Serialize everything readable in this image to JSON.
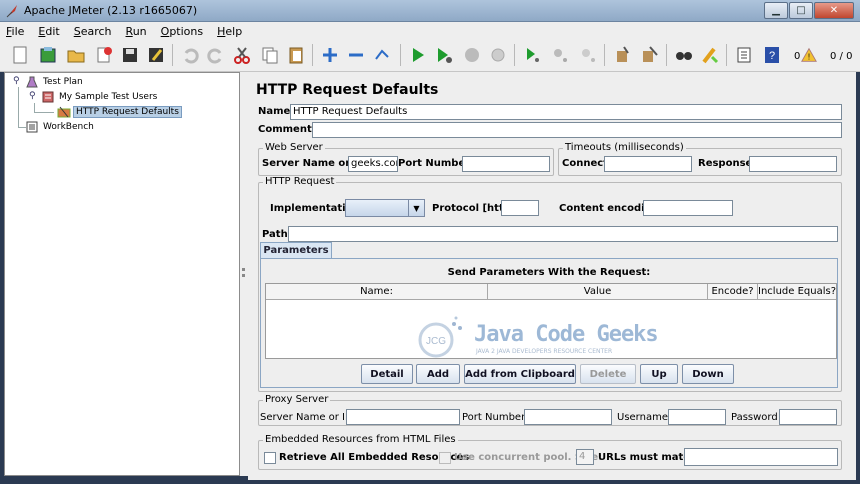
{
  "window": {
    "title": "Apache JMeter (2.13 r1665067)"
  },
  "menu": [
    {
      "label": "File",
      "u": "F",
      "rest": "ile"
    },
    {
      "label": "Edit",
      "u": "E",
      "rest": "dit"
    },
    {
      "label": "Search",
      "u": "S",
      "rest": "earch"
    },
    {
      "label": "Run",
      "u": "R",
      "rest": "un"
    },
    {
      "label": "Options",
      "u": "O",
      "rest": "ptions"
    },
    {
      "label": "Help",
      "u": "H",
      "rest": "elp"
    }
  ],
  "toolbar": {
    "warning_count": "0",
    "thread_counts": "0 / 0"
  },
  "tree": {
    "test_plan": "Test Plan",
    "thread_group": "My Sample Test Users",
    "http_defaults": "HTTP Request Defaults",
    "workbench": "WorkBench"
  },
  "panel": {
    "title": "HTTP Request Defaults",
    "name_label": "Name:",
    "name_value": "HTTP Request Defaults",
    "comments_label": "Comments:",
    "web_server": {
      "title": "Web Server",
      "server_label": "Server Name or IP:",
      "server_value": "geeks.com",
      "port_label": "Port Number:",
      "port_value": ""
    },
    "timeouts": {
      "title": "Timeouts (milliseconds)",
      "connect_label": "Connect:",
      "response_label": "Response:"
    },
    "http_request": {
      "title": "HTTP Request",
      "impl_label": "Implementation:",
      "impl_value": "",
      "protocol_label": "Protocol [http]:",
      "protocol_value": "",
      "encoding_label": "Content encoding:",
      "encoding_value": "",
      "path_label": "Path:",
      "path_value": ""
    },
    "parameters": {
      "tab": "Parameters",
      "heading": "Send Parameters With the Request:",
      "columns": [
        "Name:",
        "Value",
        "Encode?",
        "Include Equals?"
      ],
      "buttons": [
        "Detail",
        "Add",
        "Add from Clipboard",
        "Delete",
        "Up",
        "Down"
      ]
    },
    "watermark": {
      "logo": "JCG",
      "text": "Java Code Geeks",
      "sub": "JAVA 2 JAVA DEVELOPERS RESOURCE CENTER"
    },
    "proxy": {
      "title": "Proxy Server",
      "server_label": "Server Name or IP:",
      "port_label": "Port Number:",
      "username_label": "Username",
      "password_label": "Password"
    },
    "embedded": {
      "title": "Embedded Resources from HTML Files",
      "retrieve_label": "Retrieve All Embedded Resources",
      "concurrent_label": "Use concurrent pool. Size:",
      "pool_size": "4",
      "urls_label": "URLs must match:"
    }
  }
}
